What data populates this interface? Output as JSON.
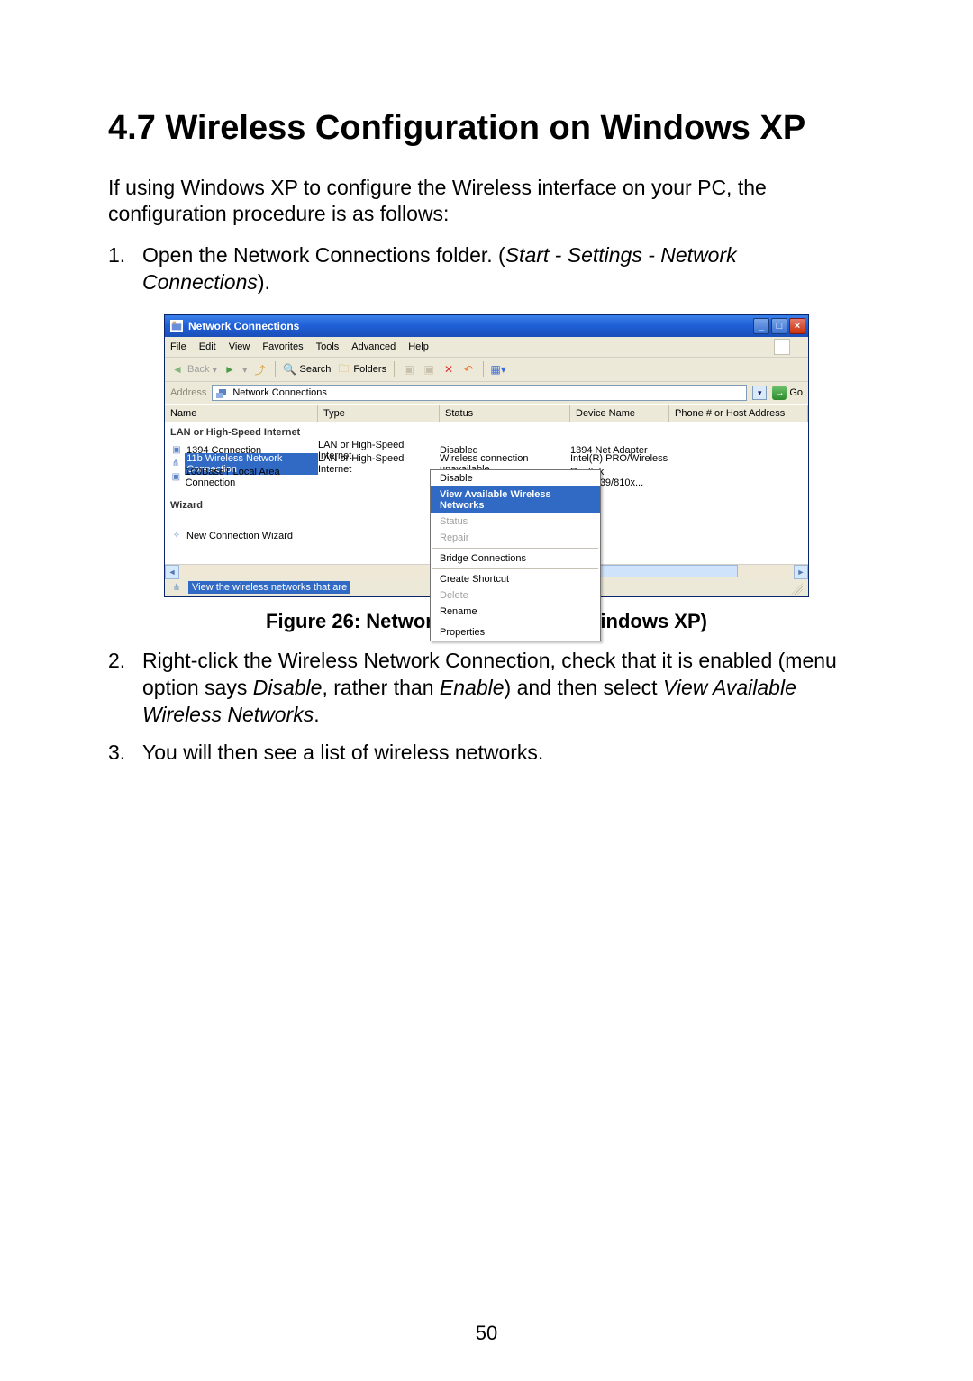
{
  "heading": "4.7   Wireless Configuration on Windows XP",
  "intro": "If using Windows XP to configure the Wireless interface on your PC, the configuration procedure is as follows:",
  "step1_pre": "Open the Network Connections folder. (",
  "step1_italic": "Start - Settings - Network Connections",
  "step1_post": ").",
  "figure_caption": "Figure 26: Network Connections (Windows XP)",
  "step2_a": "Right-click the Wireless Network Connection, check that it is enabled (menu option says ",
  "step2_disable": "Disable",
  "step2_b": ", rather than ",
  "step2_enable": "Enable",
  "step2_c": ") and then select ",
  "step2_view": "View Available Wireless Networks",
  "step2_d": ".",
  "step3": "You will then see a list of wireless networks.",
  "page_number": "50",
  "win": {
    "title": "Network Connections",
    "menu": {
      "file": "File",
      "edit": "Edit",
      "view": "View",
      "favorites": "Favorites",
      "tools": "Tools",
      "advanced": "Advanced",
      "help": "Help"
    },
    "tb": {
      "back": "Back",
      "search": "Search",
      "folders": "Folders"
    },
    "addr": {
      "label": "Address",
      "value": "Network Connections",
      "go": "Go"
    },
    "cols": {
      "name": "Name",
      "type": "Type",
      "status": "Status",
      "device": "Device Name",
      "phone": "Phone # or Host Address"
    },
    "section": "LAN or High-Speed Internet",
    "rows": [
      {
        "name": "1394 Connection",
        "type": "LAN or High-Speed Internet",
        "status": "Disabled",
        "device": "1394 Net Adapter"
      },
      {
        "name": "11b Wireless Network Connection",
        "type": "LAN or High-Speed Internet",
        "status": "Wireless connection unavailable",
        "device": "Intel(R) PRO/Wireless ..."
      },
      {
        "name": "100BaseT Local Area Connection",
        "type": "",
        "status": "",
        "device": "Realtek RTL8139/810x..."
      }
    ],
    "wizard_head": "Wizard",
    "wizard_item": "New Connection Wizard",
    "status_text": "View the wireless networks that are",
    "cm": {
      "disable": "Disable",
      "view": "View Available Wireless Networks",
      "status": "Status",
      "repair": "Repair",
      "bridge": "Bridge Connections",
      "shortcut": "Create Shortcut",
      "delete": "Delete",
      "rename": "Rename",
      "props": "Properties"
    }
  }
}
